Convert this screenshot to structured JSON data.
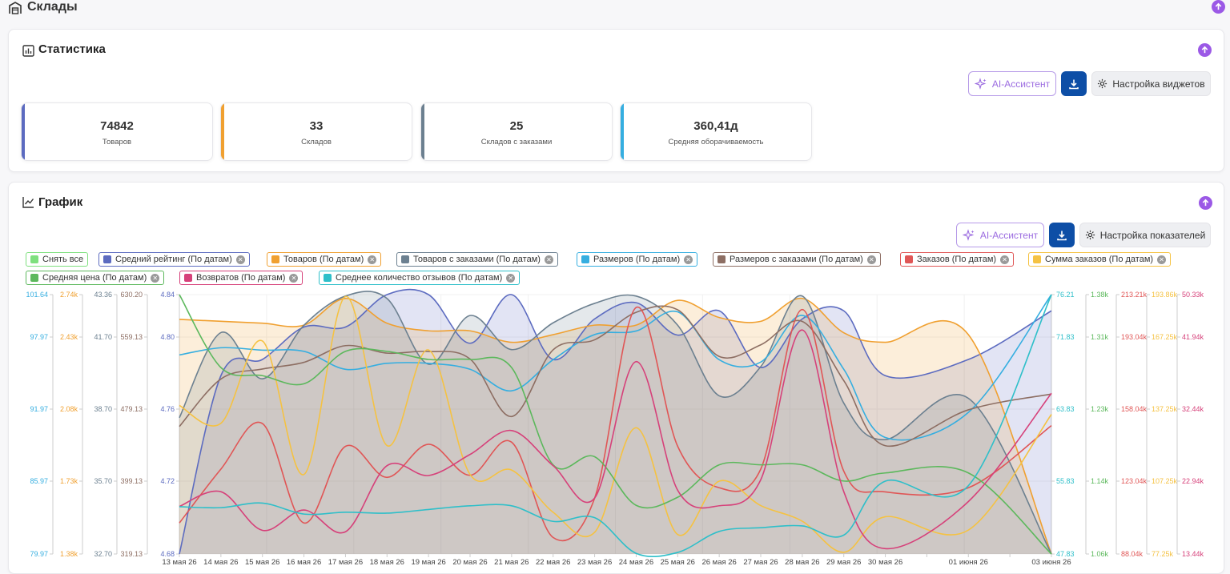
{
  "page": {
    "title": "Склады"
  },
  "stats_section": {
    "title": "Статистика",
    "ai_label": "AI-Ассистент",
    "settings_label": "Настройка виджетов",
    "cards": [
      {
        "value": "74842",
        "label": "Товаров",
        "color": "#5c6bc0"
      },
      {
        "value": "33",
        "label": "Складов",
        "color": "#f0a030"
      },
      {
        "value": "25",
        "label": "Складов с заказами",
        "color": "#6c8090"
      },
      {
        "value": "360,41д",
        "label": "Средняя оборачиваемость",
        "color": "#35aee0"
      }
    ]
  },
  "chart_section": {
    "title": "График",
    "ai_label": "AI-Ассистент",
    "settings_label": "Настройка показателей",
    "clear_all": "Снять все",
    "legend": [
      {
        "label": "Средний рейтинг (По датам)",
        "color": "#5c6bc0"
      },
      {
        "label": "Товаров (По датам)",
        "color": "#f0a030"
      },
      {
        "label": "Товаров с заказами (По датам)",
        "color": "#6c8090"
      },
      {
        "label": "Размеров (По датам)",
        "color": "#35aee0"
      },
      {
        "label": "Размеров с заказами (По датам)",
        "color": "#8d6e63"
      },
      {
        "label": "Заказов (По датам)",
        "color": "#e05656"
      },
      {
        "label": "Сумма заказов (По датам)",
        "color": "#f5c242"
      },
      {
        "label": "Средняя цена (По датам)",
        "color": "#5cb85c"
      },
      {
        "label": "Возвратов (По датам)",
        "color": "#d6417a"
      },
      {
        "label": "Среднее количество отзывов (По датам)",
        "color": "#2ebfc9"
      }
    ]
  },
  "chart_data": {
    "type": "line",
    "x": [
      "13 мая 26",
      "14 мая 26",
      "15 мая 26",
      "16 мая 26",
      "17 мая 26",
      "18 мая 26",
      "19 мая 26",
      "20 мая 26",
      "21 мая 26",
      "22 мая 26",
      "23 мая 26",
      "24 мая 26",
      "25 мая 26",
      "26 мая 26",
      "27 мая 26",
      "28 мая 26",
      "29 мая 26",
      "30 мая 26",
      "01 июня 26",
      "03 июня 26"
    ],
    "x_tick_labels": [
      "13 мая 26",
      "14 мая 26",
      "15 мая 26",
      "16 мая 26",
      "17 мая 26",
      "18 мая 26",
      "19 мая 26",
      "20 мая 26",
      "21 мая 26",
      "22 мая 26",
      "23 мая 26",
      "24 мая 26",
      "25 мая 26",
      "26 мая 26",
      "27 мая 26",
      "28 мая 26",
      "29 мая 26",
      "30 мая 26",
      "",
      "01 июня 26",
      "",
      "03 июня 26"
    ],
    "axes": [
      {
        "side": "left",
        "color": "#35aee0",
        "ticks": [
          "101.64",
          "97.97",
          "91.97",
          "85.97",
          "79.97"
        ]
      },
      {
        "side": "left",
        "color": "#f0a030",
        "ticks": [
          "2.74k",
          "2.43k",
          "2.08k",
          "1.73k",
          "1.38k"
        ]
      },
      {
        "side": "left",
        "color": "#6c8090",
        "ticks": [
          "43.36",
          "41.70",
          "38.70",
          "35.70",
          "32.70"
        ]
      },
      {
        "side": "left",
        "color": "#8d6e63",
        "ticks": [
          "630.20",
          "559.13",
          "479.13",
          "399.13",
          "319.13"
        ]
      },
      {
        "side": "left",
        "color": "#5c6bc0",
        "ticks": [
          "4.84",
          "4.80",
          "4.76",
          "4.72",
          "4.68"
        ]
      },
      {
        "side": "right",
        "color": "#2ebfc9",
        "ticks": [
          "76.21",
          "71.83",
          "63.83",
          "55.83",
          "47.83"
        ]
      },
      {
        "side": "right",
        "color": "#5cb85c",
        "ticks": [
          "1.38k",
          "1.31k",
          "1.23k",
          "1.14k",
          "1.06k"
        ]
      },
      {
        "side": "right",
        "color": "#e05656",
        "ticks": [
          "213.21k",
          "193.04k",
          "158.04k",
          "123.04k",
          "88.04k"
        ]
      },
      {
        "side": "right",
        "color": "#f5c242",
        "ticks": [
          "193.86k",
          "167.25k",
          "137.25k",
          "107.25k",
          "77.25k"
        ]
      },
      {
        "side": "right",
        "color": "#d6417a",
        "ticks": [
          "50.33k",
          "41.94k",
          "32.44k",
          "22.94k",
          "13.44k"
        ]
      }
    ],
    "series": [
      {
        "name": "Средний рейтинг (По датам)",
        "color": "#5c6bc0",
        "fill": true,
        "values": [
          4.68,
          4.79,
          4.8,
          4.82,
          4.82,
          4.84,
          4.84,
          4.81,
          4.84,
          4.8,
          4.825,
          4.835,
          4.815,
          4.83,
          4.795,
          4.825,
          4.83,
          4.79,
          4.8,
          4.83
        ]
      },
      {
        "name": "Товаров (По датам)",
        "color": "#f0a030",
        "fill": true,
        "values": [
          2.61,
          2.6,
          2.59,
          2.58,
          2.72,
          2.59,
          2.55,
          2.55,
          2.49,
          2.53,
          2.58,
          2.58,
          2.71,
          2.62,
          2.6,
          2.72,
          2.54,
          2.49,
          2.53,
          1.38
        ]
      },
      {
        "name": "Товаров с заказами (По датам)",
        "color": "#6c8090",
        "fill": true,
        "values": [
          38.3,
          41.8,
          39.9,
          42.1,
          43.3,
          43.2,
          40.5,
          42.5,
          41.1,
          42.2,
          43.0,
          43.3,
          42.1,
          39.2,
          40.4,
          43.3,
          38.9,
          37.4,
          39.1,
          32.7
        ]
      },
      {
        "name": "Размеров (По датам)",
        "color": "#35aee0",
        "fill": false,
        "values": [
          96.6,
          97.2,
          97.0,
          96.9,
          95.4,
          95.9,
          95.9,
          95.4,
          93.6,
          96.2,
          98.3,
          98.6,
          100.2,
          96.2,
          96.0,
          99.9,
          95.4,
          89.7,
          91.8,
          101.64
        ]
      },
      {
        "name": "Размеров с заказами (По датам)",
        "color": "#8d6e63",
        "fill": false,
        "values": [
          472,
          529,
          541,
          549,
          569,
          560,
          562,
          553,
          484,
          564,
          576,
          609,
          612,
          556,
          570,
          598,
          527,
          449,
          492,
          511
        ]
      },
      {
        "name": "Заказов (По датам)",
        "color": "#e05656",
        "fill": false,
        "values": [
          103,
          129,
          151,
          103,
          140,
          125,
          141,
          126,
          142,
          96,
          115,
          207,
          140,
          120,
          129,
          206,
          128,
          118,
          120,
          150
        ]
      },
      {
        "name": "Сумма заказов (По датам)",
        "color": "#f5c242",
        "fill": false,
        "values": [
          144,
          136,
          173,
          113,
          193,
          126,
          169,
          113,
          115,
          96,
          87,
          134,
          86,
          110,
          99,
          92,
          78,
          94,
          88,
          140
        ]
      },
      {
        "name": "Средняя цена (По датам)",
        "color": "#5cb85c",
        "fill": false,
        "values": [
          1.38,
          1.29,
          1.28,
          1.27,
          1.31,
          1.31,
          1.3,
          1.3,
          1.29,
          1.17,
          1.18,
          1.12,
          1.13,
          1.17,
          1.17,
          1.17,
          1.15,
          1.16,
          1.16,
          1.06
        ]
      },
      {
        "name": "Возвратов (По датам)",
        "color": "#d6417a",
        "fill": false,
        "values": [
          20.2,
          22.3,
          16.8,
          19.7,
          16.6,
          26.0,
          24.6,
          27.6,
          31.0,
          26.0,
          21.4,
          40.8,
          22.5,
          20.3,
          24.0,
          45.3,
          22.3,
          14.2,
          20.9,
          36.3
        ]
      },
      {
        "name": "Среднее количество отзывов (По датам)",
        "color": "#2ebfc9",
        "fill": false,
        "values": [
          53.0,
          52.9,
          53.4,
          52.2,
          52.4,
          52.3,
          52.7,
          53.1,
          53.1,
          51.4,
          51.8,
          47.9,
          48.0,
          50.3,
          50.7,
          50.9,
          49.9,
          55.8,
          55.3,
          76.21
        ]
      }
    ]
  }
}
